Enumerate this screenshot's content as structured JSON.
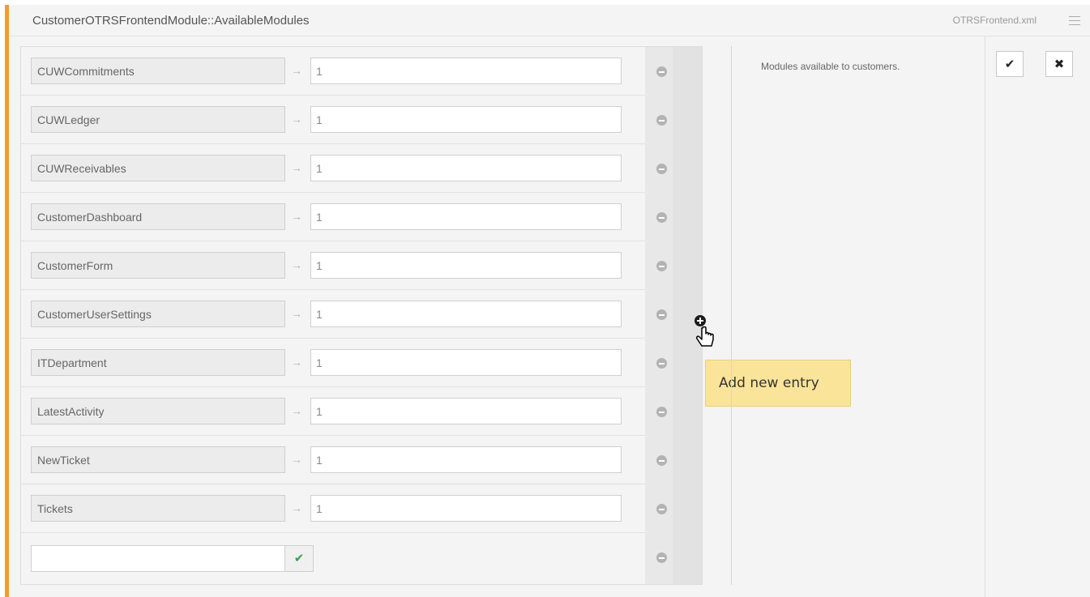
{
  "setting": {
    "name": "CustomerOTRSFrontendModule::AvailableModules",
    "file": "OTRSFrontend.xml",
    "description": "Modules available to customers."
  },
  "entries": [
    {
      "key": "CUWCommitments",
      "value": "1"
    },
    {
      "key": "CUWLedger",
      "value": "1"
    },
    {
      "key": "CUWReceivables",
      "value": "1"
    },
    {
      "key": "CustomerDashboard",
      "value": "1"
    },
    {
      "key": "CustomerForm",
      "value": "1"
    },
    {
      "key": "CustomerUserSettings",
      "value": "1"
    },
    {
      "key": "ITDepartment",
      "value": "1"
    },
    {
      "key": "LatestActivity",
      "value": "1"
    },
    {
      "key": "NewTicket",
      "value": "1"
    },
    {
      "key": "Tickets",
      "value": "1"
    }
  ],
  "new_entry": {
    "key": "",
    "confirm_icon": "checkmark-icon"
  },
  "tooltip": {
    "text": "Add new entry"
  },
  "icons": {
    "arrow": "→",
    "remove": "minus-circle-icon",
    "add": "plus-circle-icon",
    "save": "✔",
    "cancel": "✖"
  },
  "colors": {
    "accent": "#f39c26",
    "tooltip_bg": "#fae49a",
    "confirm_green": "#3aa34a"
  }
}
